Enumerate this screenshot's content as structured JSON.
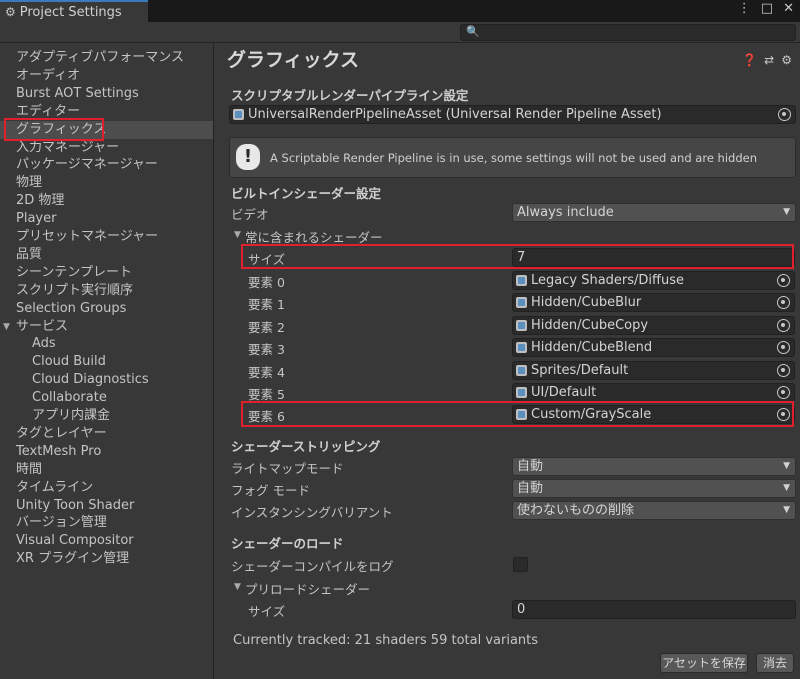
{
  "window": {
    "title": "Project Settings"
  },
  "search": {
    "placeholder": ""
  },
  "sidebar": {
    "items": [
      {
        "label": "アダプティブパフォーマンス"
      },
      {
        "label": "オーディオ"
      },
      {
        "label": "Burst AOT Settings"
      },
      {
        "label": "エディター"
      },
      {
        "label": "グラフィックス",
        "selected": true
      },
      {
        "label": "入力マネージャー"
      },
      {
        "label": "パッケージマネージャー"
      },
      {
        "label": "物理"
      },
      {
        "label": "2D 物理"
      },
      {
        "label": "Player"
      },
      {
        "label": "プリセットマネージャー"
      },
      {
        "label": "品質"
      },
      {
        "label": "シーンテンプレート"
      },
      {
        "label": "スクリプト実行順序"
      },
      {
        "label": "Selection Groups"
      },
      {
        "label": "サービス",
        "expanded": true
      },
      {
        "label": "Ads",
        "sub": true
      },
      {
        "label": "Cloud Build",
        "sub": true
      },
      {
        "label": "Cloud Diagnostics",
        "sub": true
      },
      {
        "label": "Collaborate",
        "sub": true
      },
      {
        "label": "アプリ内課金",
        "sub": true
      },
      {
        "label": "タグとレイヤー"
      },
      {
        "label": "TextMesh Pro"
      },
      {
        "label": "時間"
      },
      {
        "label": "タイムライン"
      },
      {
        "label": "Unity Toon Shader"
      },
      {
        "label": "バージョン管理"
      },
      {
        "label": "Visual Compositor"
      },
      {
        "label": "XR プラグイン管理"
      }
    ]
  },
  "main": {
    "title": "グラフィックス",
    "srp": {
      "section": "スクリプタブルレンダーパイプライン設定",
      "asset": "UniversalRenderPipelineAsset (Universal Render Pipeline Asset)",
      "help": "A Scriptable Render Pipeline is in use, some settings will not be used and are hidden"
    },
    "builtin": {
      "section": "ビルトインシェーダー設定",
      "video_label": "ビデオ",
      "video_value": "Always include",
      "always_label": "常に含まれるシェーダー",
      "size_label": "サイズ",
      "size_value": "7",
      "elements": [
        {
          "label": "要素 0",
          "value": "Legacy Shaders/Diffuse"
        },
        {
          "label": "要素 1",
          "value": "Hidden/CubeBlur"
        },
        {
          "label": "要素 2",
          "value": "Hidden/CubeCopy"
        },
        {
          "label": "要素 3",
          "value": "Hidden/CubeBlend"
        },
        {
          "label": "要素 4",
          "value": "Sprites/Default"
        },
        {
          "label": "要素 5",
          "value": "UI/Default"
        },
        {
          "label": "要素 6",
          "value": "Custom/GrayScale"
        }
      ]
    },
    "stripping": {
      "section": "シェーダーストリッピング",
      "lightmap_label": "ライトマップモード",
      "lightmap_value": "自動",
      "fog_label": "フォグ モード",
      "fog_value": "自動",
      "instancing_label": "インスタンシングバリアント",
      "instancing_value": "使わないものの削除"
    },
    "loading": {
      "section": "シェーダーのロード",
      "log_label": "シェーダーコンパイルをログ",
      "log_checked": false,
      "preload_label": "プリロードシェーダー",
      "preload_size_label": "サイズ",
      "preload_size_value": "0"
    },
    "tracked": "Currently tracked: 21 shaders 59 total variants",
    "buttons": {
      "save": "アセットを保存",
      "clear": "消去"
    }
  },
  "colors": {
    "highlight": "#e0202d",
    "background": "#383838",
    "field": "#2a2a2a"
  }
}
